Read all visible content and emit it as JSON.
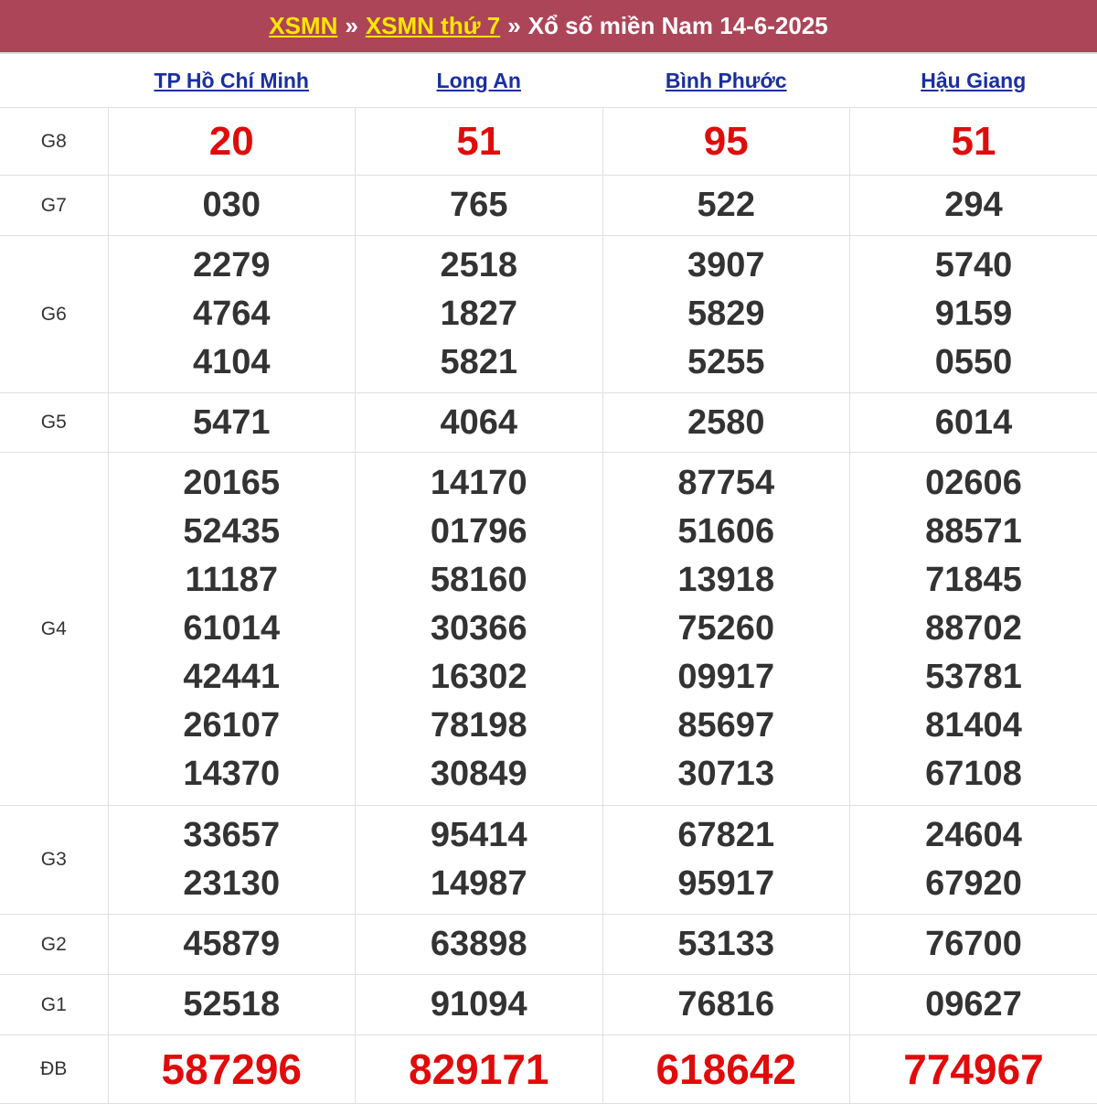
{
  "header": {
    "link1": "XSMN",
    "sep1": "»",
    "link2": "XSMN thứ 7",
    "sep2": "»",
    "title": "Xổ số miền Nam 14-6-2025"
  },
  "provinces": [
    "TP Hồ Chí Minh",
    "Long An",
    "Bình Phước",
    "Hậu Giang"
  ],
  "prizes": [
    {
      "label": "G8",
      "results": [
        [
          "20"
        ],
        [
          "51"
        ],
        [
          "95"
        ],
        [
          "51"
        ]
      ]
    },
    {
      "label": "G7",
      "results": [
        [
          "030"
        ],
        [
          "765"
        ],
        [
          "522"
        ],
        [
          "294"
        ]
      ]
    },
    {
      "label": "G6",
      "results": [
        [
          "2279",
          "4764",
          "4104"
        ],
        [
          "2518",
          "1827",
          "5821"
        ],
        [
          "3907",
          "5829",
          "5255"
        ],
        [
          "5740",
          "9159",
          "0550"
        ]
      ]
    },
    {
      "label": "G5",
      "results": [
        [
          "5471"
        ],
        [
          "4064"
        ],
        [
          "2580"
        ],
        [
          "6014"
        ]
      ]
    },
    {
      "label": "G4",
      "results": [
        [
          "20165",
          "52435",
          "11187",
          "61014",
          "42441",
          "26107",
          "14370"
        ],
        [
          "14170",
          "01796",
          "58160",
          "30366",
          "16302",
          "78198",
          "30849"
        ],
        [
          "87754",
          "51606",
          "13918",
          "75260",
          "09917",
          "85697",
          "30713"
        ],
        [
          "02606",
          "88571",
          "71845",
          "88702",
          "53781",
          "81404",
          "67108"
        ]
      ]
    },
    {
      "label": "G3",
      "results": [
        [
          "33657",
          "23130"
        ],
        [
          "95414",
          "14987"
        ],
        [
          "67821",
          "95917"
        ],
        [
          "24604",
          "67920"
        ]
      ]
    },
    {
      "label": "G2",
      "results": [
        [
          "45879"
        ],
        [
          "63898"
        ],
        [
          "53133"
        ],
        [
          "76700"
        ]
      ]
    },
    {
      "label": "G1",
      "results": [
        [
          "52518"
        ],
        [
          "91094"
        ],
        [
          "76816"
        ],
        [
          "09627"
        ]
      ]
    },
    {
      "label": "ĐB",
      "results": [
        [
          "587296"
        ],
        [
          "829171"
        ],
        [
          "618642"
        ],
        [
          "774967"
        ]
      ]
    }
  ],
  "colors": {
    "header_bg": "#ad4558",
    "header_link": "#ffe600",
    "province_link": "#1a2fa0",
    "highlight_red": "#e00b0b",
    "number_text": "#333333"
  }
}
